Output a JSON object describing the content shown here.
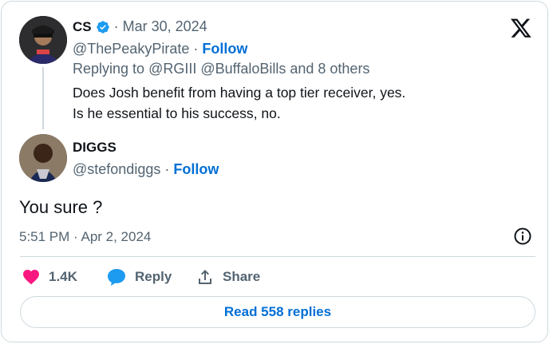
{
  "quoted": {
    "name": "CS",
    "date": "Mar 30, 2024",
    "handle": "@ThePeakyPirate",
    "follow_label": "Follow",
    "replying_prefix": "Replying to",
    "replying_mentions": "@RGIII @BuffaloBills",
    "replying_suffix": "and 8 others",
    "text_line1": "Does Josh benefit from having a top tier receiver, yes.",
    "text_line2": "Is he essential to his success, no."
  },
  "main": {
    "name": "DIGGS",
    "handle": "@stefondiggs",
    "follow_label": "Follow",
    "text": "You sure ?",
    "timestamp": "5:51 PM · Apr 2, 2024"
  },
  "actions": {
    "likes": "1.4K",
    "reply_label": "Reply",
    "share_label": "Share"
  },
  "read_replies_label": "Read 558 replies",
  "colors": {
    "link": "#006fd6",
    "like": "#f91880",
    "reply_icon": "#1d9bf0",
    "verified": "#1d9bf0"
  },
  "icons": [
    "x-logo-icon",
    "verified-badge-icon",
    "info-icon",
    "heart-icon",
    "reply-bubble-icon",
    "share-icon"
  ]
}
